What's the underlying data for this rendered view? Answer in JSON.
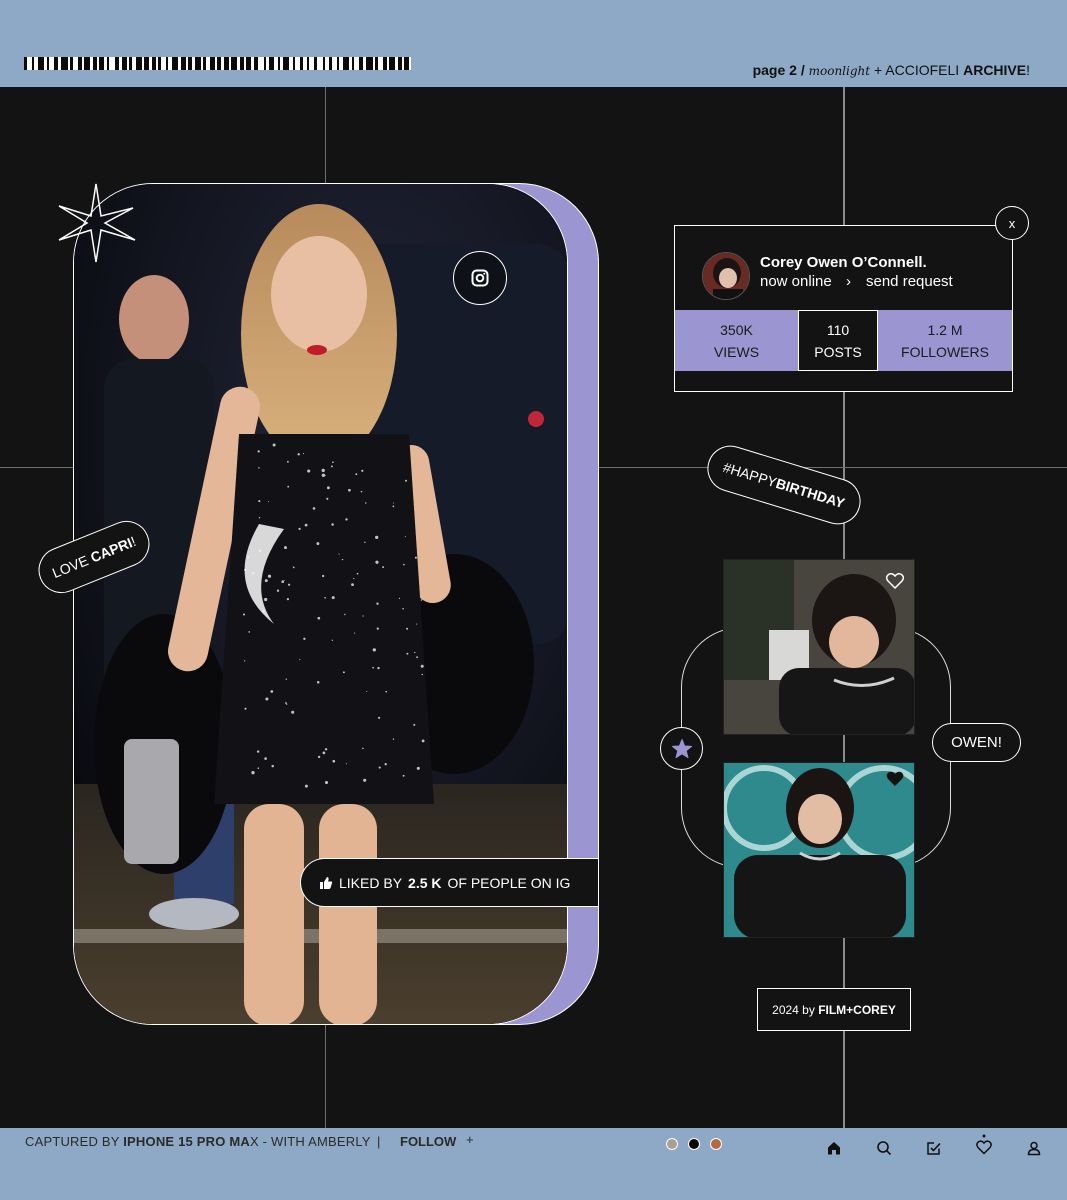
{
  "header": {
    "page_label": "page 2 /",
    "script_word": "moonlight",
    "plus": "+",
    "brand": "ACCIOFELI",
    "archive": "ARCHIVE",
    "bang": "!"
  },
  "phone": {
    "love_prefix": "LOVE",
    "love_name": "CAPRI",
    "love_bang": "!",
    "liked_prefix": "LIKED BY",
    "liked_count": "2.5 K",
    "liked_suffix": "OF PEOPLE ON IG",
    "instagram_icon": "instagram-icon",
    "like_icon": "thumbs-up-icon",
    "sparkle_icon": "eight-point-star-icon"
  },
  "profile": {
    "name": "Corey Owen O’Connell.",
    "status": "now online",
    "chevron": "›",
    "action": "send request",
    "close": "x",
    "stats": [
      {
        "value": "350K",
        "label": "VIEWS"
      },
      {
        "value": "110",
        "label": "POSTS"
      },
      {
        "value": "1.2 M",
        "label": "FOLLOWERS"
      }
    ]
  },
  "hashtag": {
    "prefix": "#HAPPY",
    "bold": "BIRTHDAY"
  },
  "gallery": {
    "label": "OWEN!",
    "heart_icon": "heart-icon",
    "star_icon": "star-icon"
  },
  "credit": {
    "prefix": "2024 by",
    "bold": "FILM+COREY"
  },
  "footer": {
    "captured_prefix": "CAPTURED BY",
    "device": "IPHONE 15 PRO MA",
    "device_tail": "X - WITH AMBERLY",
    "separator": "|",
    "follow": "FOLLOW",
    "plus": "+",
    "swatches": [
      "#a89f97",
      "#050505",
      "#b5683f"
    ],
    "nav_icons": [
      "home-icon",
      "search-icon",
      "edit-check-icon",
      "heart-notification-icon",
      "user-icon"
    ]
  },
  "colors": {
    "lavender": "#9b95d1",
    "sky": "#8ea9c5",
    "background": "#131313"
  }
}
